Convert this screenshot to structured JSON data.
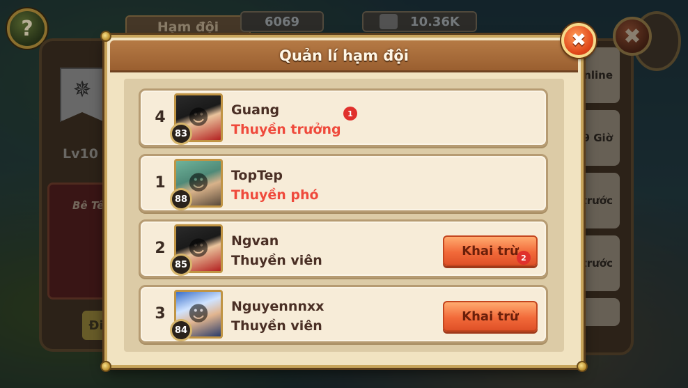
{
  "background": {
    "help_label": "?",
    "top_tab_label": "Hạm đội",
    "top_value_1": "6069",
    "top_value_2": "10.36K",
    "flag_icon": "✵",
    "level_text": "Lv10",
    "card_text": "Bê Tê",
    "small_button_label": "Đi",
    "right_items": [
      "Online",
      "9 Giờ",
      "t trước",
      "t trước",
      ""
    ],
    "close_label": "✖"
  },
  "dialog": {
    "title": "Quản lí hạm đội",
    "close_label": "✖"
  },
  "members": [
    {
      "rank": "4",
      "name": "Guang",
      "role": "Thuyền trưởng",
      "level": "83",
      "avatar": "luffy",
      "kick_label": ""
    },
    {
      "rank": "1",
      "name": "TopTep",
      "role": "Thuyền phó",
      "level": "88",
      "avatar": "zoro",
      "kick_label": ""
    },
    {
      "rank": "2",
      "name": "Ngvan",
      "role": "Thuyền viên",
      "level": "85",
      "avatar": "luffy",
      "kick_label": "Khai trừ"
    },
    {
      "rank": "3",
      "name": "Nguyennnxx",
      "role": "Thuyền viên",
      "level": "84",
      "avatar": "marco",
      "kick_label": "Khai trừ"
    }
  ],
  "markers": [
    "1",
    "2"
  ],
  "colors": {
    "officer_role": "#ef4a3c",
    "member_role": "#4a2f25",
    "header": "#a8693a",
    "kick_button": "#f26a3a"
  }
}
